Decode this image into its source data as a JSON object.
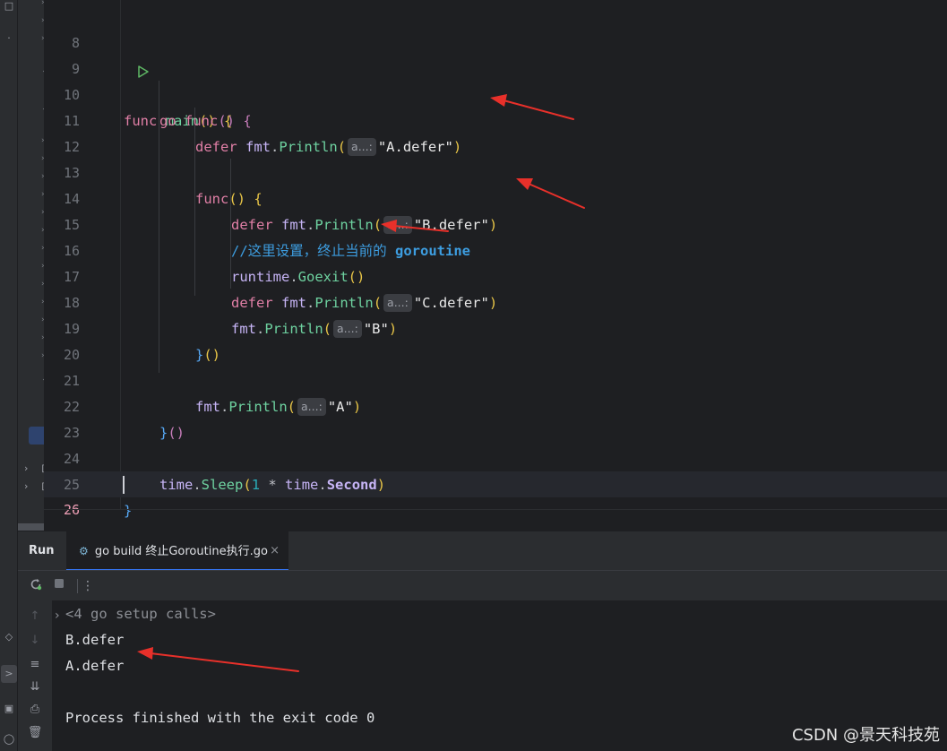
{
  "editor": {
    "lines": [
      {
        "n": "8"
      },
      {
        "n": "9"
      },
      {
        "n": "10"
      },
      {
        "n": "11"
      },
      {
        "n": "12"
      },
      {
        "n": "13"
      },
      {
        "n": "14"
      },
      {
        "n": "15"
      },
      {
        "n": "16"
      },
      {
        "n": "17"
      },
      {
        "n": "18"
      },
      {
        "n": "19"
      },
      {
        "n": "20"
      },
      {
        "n": "21"
      },
      {
        "n": "22"
      },
      {
        "n": "23"
      },
      {
        "n": "24"
      },
      {
        "n": "25"
      },
      {
        "n": "26"
      }
    ],
    "code": {
      "l9_func": "func",
      "l9_main": "main",
      "l9_rest": "()",
      "l9_brace": "{",
      "l10_go": "go",
      "l10_func": "func",
      "l10_paren": "()",
      "l10_brace": "{",
      "l11_defer": "defer",
      "l11_pkg": "fmt",
      "l11_fn": "Println",
      "l11_hint": "a...:",
      "l11_str": "\"A.defer\"",
      "l13_func": "func",
      "l13_paren": "()",
      "l13_brace": "{",
      "l14_defer": "defer",
      "l14_pkg": "fmt",
      "l14_fn": "Println",
      "l14_hint": "a...:",
      "l14_str": "\"B.defer\"",
      "l15_comment": "//这里设置，终止当前的 ",
      "l15_comment_bold": "goroutine",
      "l16_pkg": "runtime",
      "l16_fn": "Goexit",
      "l16_paren": "()",
      "l17_defer": "defer",
      "l17_pkg": "fmt",
      "l17_fn": "Println",
      "l17_hint": "a...:",
      "l17_str": "\"C.defer\"",
      "l18_pkg": "fmt",
      "l18_fn": "Println",
      "l18_hint": "a...:",
      "l18_str": "\"B\"",
      "l19_close": "}",
      "l19_paren": "()",
      "l21_pkg": "fmt",
      "l21_fn": "Println",
      "l21_hint": "a...:",
      "l21_str": "\"A\"",
      "l22_close": "}",
      "l22_paren": "()",
      "l24_pkg": "time",
      "l24_fn": "Sleep",
      "l24_num": "1",
      "l24_op": " * ",
      "l24_pkg2": "time",
      "l24_const": "Second",
      "l25_close": "}"
    }
  },
  "run_panel": {
    "title": "Run",
    "tab_label": "go build 终止Goroutine执行.go",
    "toolbar": {
      "rerun_icon": "rerun-icon",
      "stop_icon": "stop-icon",
      "more_icon": "more-vertical-icon"
    },
    "console": {
      "setup_calls": "<4 go setup calls>",
      "out1": "B.defer",
      "out2": "A.defer",
      "finished": "Process finished with the exit code 0"
    }
  },
  "watermark": "CSDN @景天科技苑",
  "colors": {
    "background": "#1e1f22",
    "panel": "#2b2d30",
    "accent": "#3574f0",
    "annotation_arrow": "#e8302a"
  }
}
